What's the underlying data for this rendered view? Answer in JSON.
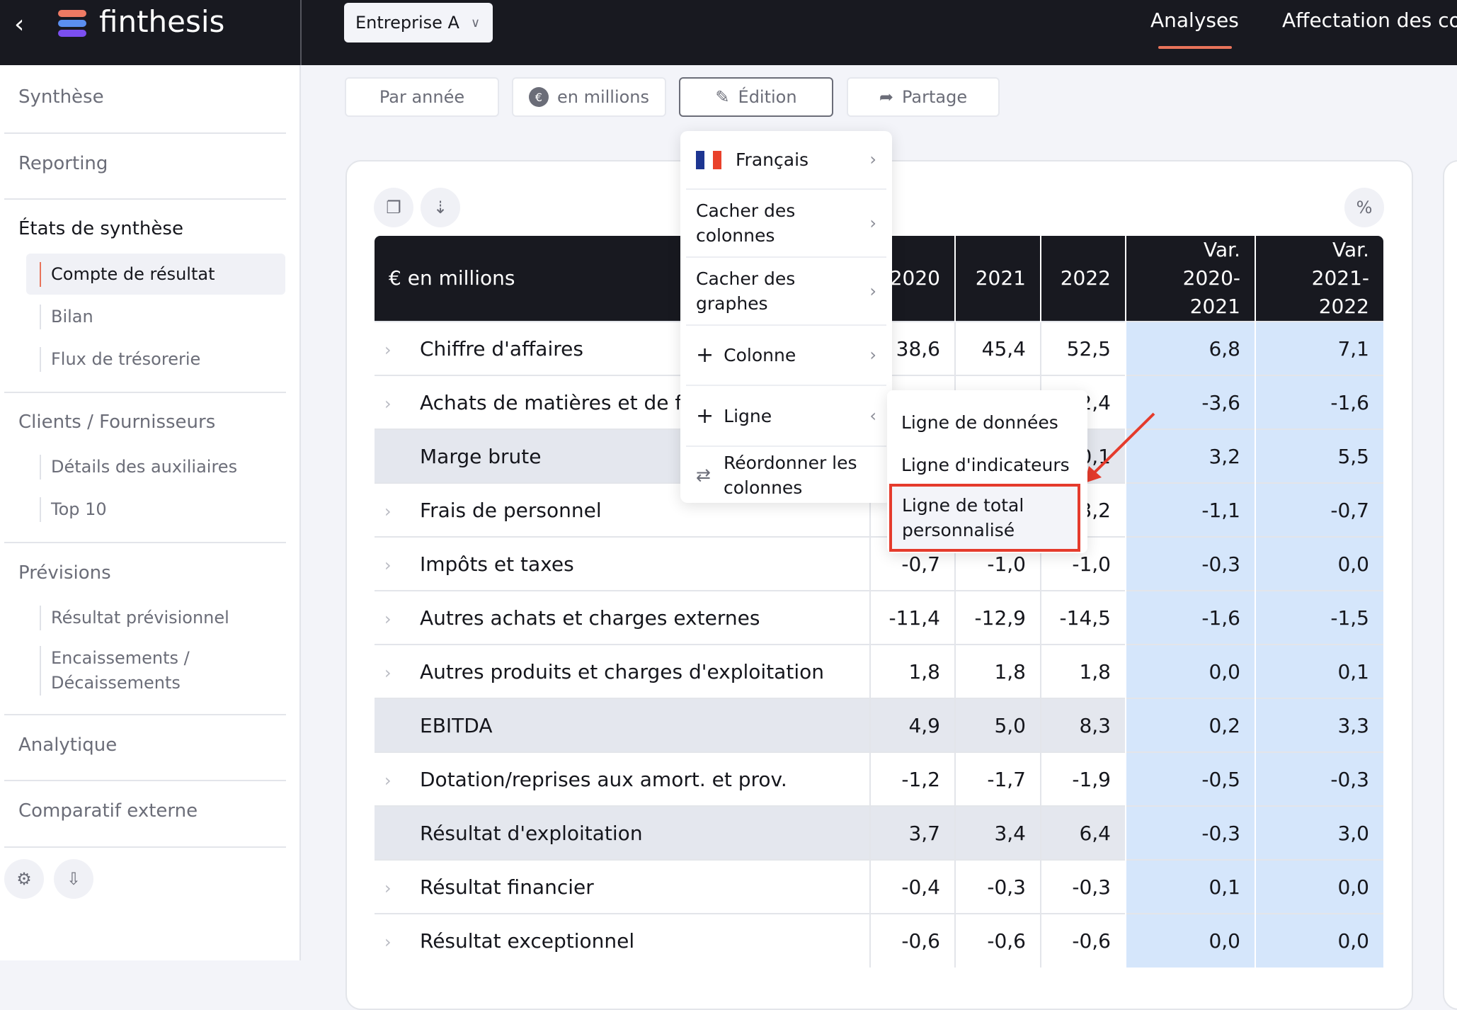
{
  "topbar": {
    "app_name": "finthesis",
    "company": "Entreprise A",
    "tabs": [
      {
        "label": "Analyses",
        "active": true
      },
      {
        "label": "Affectation des co"
      }
    ],
    "accent": "#e8735a"
  },
  "sidebar": {
    "sections": [
      "Synthèse",
      "Reporting",
      "États de synthèse",
      "Clients / Fournisseurs",
      "Prévisions",
      "Analytique",
      "Comparatif externe"
    ],
    "etats_items": [
      "Compte de résultat",
      "Bilan",
      "Flux de trésorerie"
    ],
    "clients_items": [
      "Détails des auxiliaires",
      "Top 10"
    ],
    "previsions_items": [
      "Résultat prévisionnel",
      "Encaissements / Décaissements"
    ]
  },
  "toolbar": {
    "period": "Par année",
    "units": "en millions",
    "edit": "Édition",
    "share": "Partage"
  },
  "table": {
    "percent": "%",
    "headers": [
      "€ en millions",
      "2020",
      "2021",
      "2022",
      "Var. 2020-2021",
      "Var. 2021-2022"
    ],
    "rows": [
      {
        "label": "Chiffre d'affaires",
        "values": [
          "38,6",
          "45,4",
          "52,5",
          "6,8",
          "7,1"
        ],
        "total": false
      },
      {
        "label": "Achats de matières et de f",
        "values": [
          "",
          "",
          "-2,4",
          "-3,6",
          "-1,6"
        ],
        "total": false
      },
      {
        "label": "Marge brute",
        "values": [
          "",
          "",
          "0,1",
          "3,2",
          "5,5"
        ],
        "total": true
      },
      {
        "label": "Frais de personnel",
        "values": [
          "",
          "",
          "-3,2",
          "-1,1",
          "-0,7"
        ],
        "total": false
      },
      {
        "label": "Impôts et taxes",
        "values": [
          "-0,7",
          "-1,0",
          "-1,0",
          "-0,3",
          "0,0"
        ],
        "total": false
      },
      {
        "label": "Autres achats et charges externes",
        "values": [
          "-11,4",
          "-12,9",
          "-14,5",
          "-1,6",
          "-1,5"
        ],
        "total": false
      },
      {
        "label": "Autres produits et charges d'exploitation",
        "values": [
          "1,8",
          "1,8",
          "1,8",
          "0,0",
          "0,1"
        ],
        "total": false
      },
      {
        "label": "EBITDA",
        "values": [
          "4,9",
          "5,0",
          "8,3",
          "0,2",
          "3,3"
        ],
        "total": true
      },
      {
        "label": "Dotation/reprises aux amort. et prov.",
        "values": [
          "-1,2",
          "-1,7",
          "-1,9",
          "-0,5",
          "-0,3"
        ],
        "total": false
      },
      {
        "label": "Résultat d'exploitation",
        "values": [
          "3,7",
          "3,4",
          "6,4",
          "-0,3",
          "3,0"
        ],
        "total": true
      },
      {
        "label": "Résultat financier",
        "values": [
          "-0,4",
          "-0,3",
          "-0,3",
          "0,1",
          "0,0"
        ],
        "total": false
      },
      {
        "label": "Résultat exceptionnel",
        "values": [
          "-0,6",
          "-0,6",
          "-0,6",
          "0,0",
          "0,0"
        ],
        "total": false
      }
    ]
  },
  "edit_menu": {
    "items": [
      "Français",
      "Cacher des colonnes",
      "Cacher des graphes",
      "Colonne",
      "Ligne",
      "Réordonner les colonnes"
    ]
  },
  "ligne_submenu": {
    "items": [
      "Ligne de données",
      "Ligne d'indicateurs",
      "Ligne de total personnalisé"
    ],
    "highlighted": "Ligne de total personnalisé",
    "highlight_color": "#e53b2c"
  }
}
